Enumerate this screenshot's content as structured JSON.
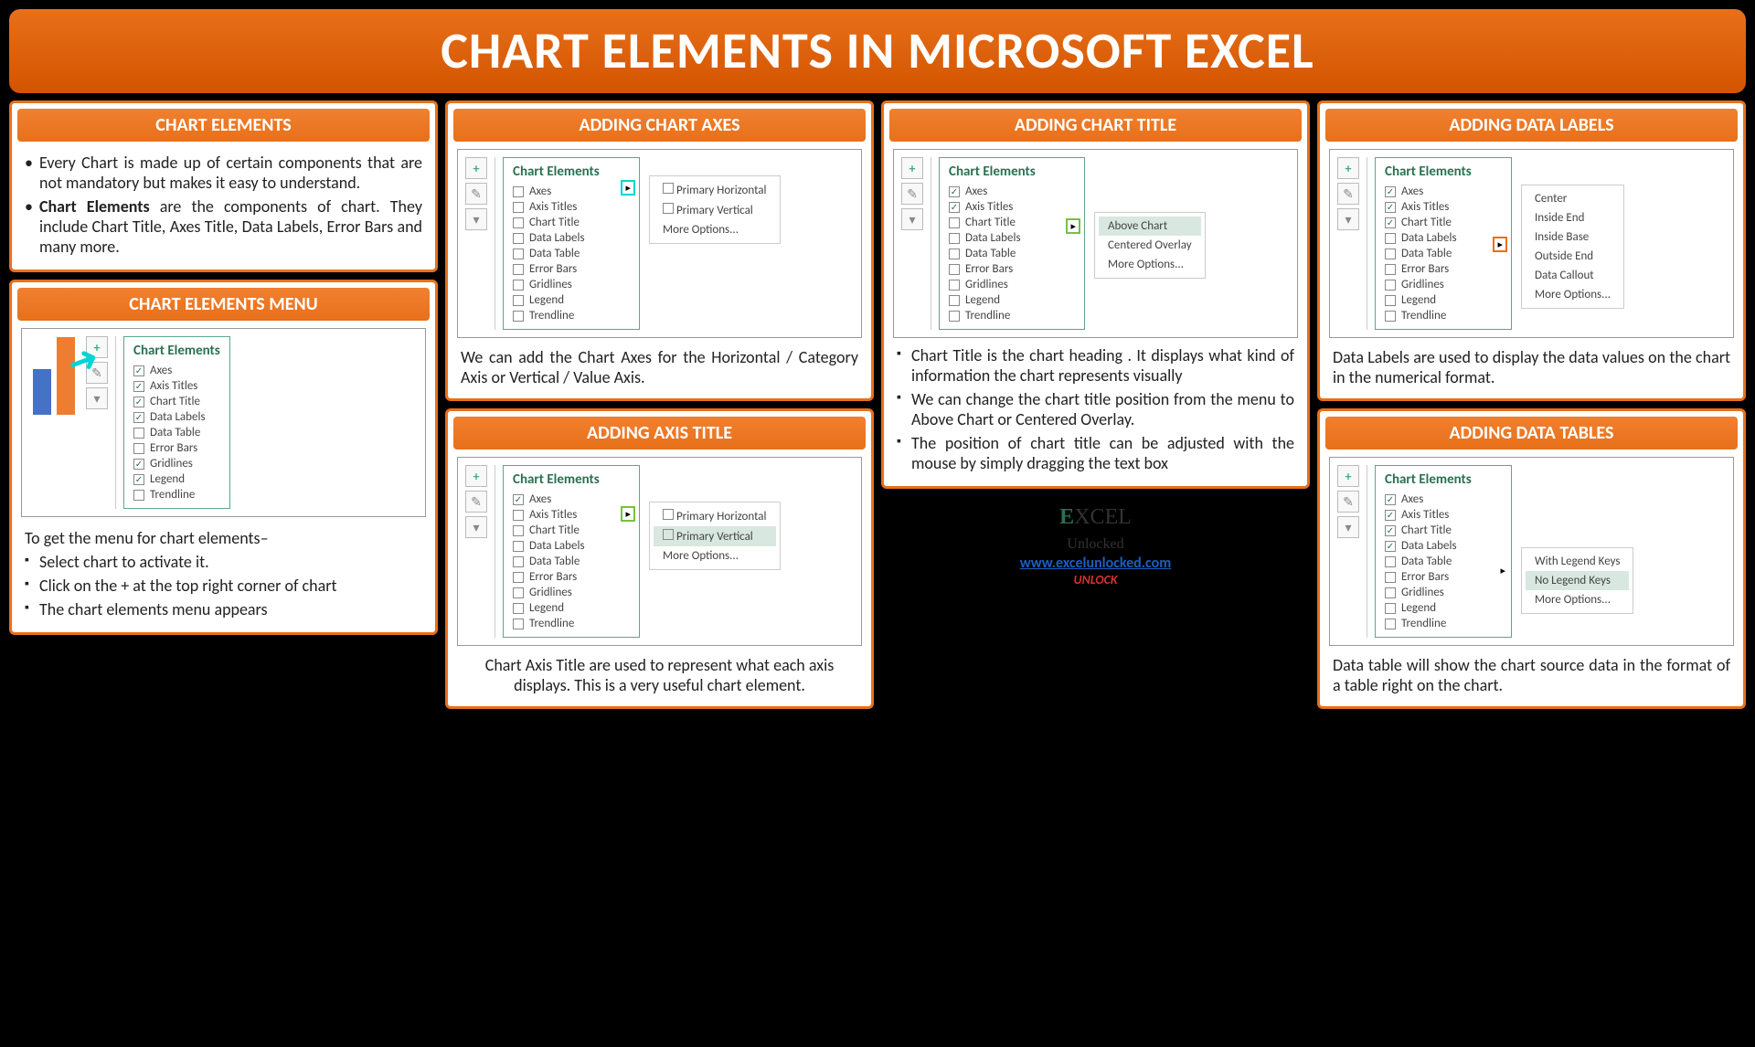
{
  "title": "CHART ELEMENTS IN MICROSOFT EXCEL",
  "cards": {
    "elements": {
      "title": "CHART ELEMENTS",
      "bullets": [
        "Every Chart is made up of certain components that are not mandatory but makes it easy to understand.",
        "Chart Elements are the components of chart. They include Chart Title, Axes Title, Data Labels, Error Bars and many more."
      ]
    },
    "menu": {
      "title": "CHART ELEMENTS MENU",
      "intro": "To get the menu for chart elements–",
      "bullets": [
        "Select chart to activate it.",
        "Click on the + at the top right corner of chart",
        "The chart elements menu appears"
      ]
    },
    "axes": {
      "title": "ADDING CHART AXES",
      "caption": "We can add the Chart Axes for the Horizontal / Category Axis or Vertical / Value Axis.",
      "submenu": [
        "Primary Horizontal",
        "Primary Vertical",
        "More Options..."
      ]
    },
    "axisTitle": {
      "title": "ADDING AXIS TITLE",
      "caption": "Chart Axis Title are used to represent what each axis displays. This is a very useful chart element.",
      "submenu": [
        "Primary Horizontal",
        "Primary Vertical",
        "More Options..."
      ]
    },
    "chartTitle": {
      "title": "ADDING CHART TITLE",
      "submenu": [
        "Above Chart",
        "Centered Overlay",
        "More Options..."
      ],
      "bullets": [
        "Chart Title is the chart heading . It displays what kind of information the chart represents visually",
        "We can change the chart title position from the menu to Above Chart or Centered Overlay.",
        "The position of chart title can be adjusted with the mouse by simply dragging the text box"
      ]
    },
    "dataLabels": {
      "title": "ADDING DATA LABELS",
      "caption": "Data Labels are used to display the data values on the chart in the numerical format.",
      "submenu": [
        "Center",
        "Inside End",
        "Inside Base",
        "Outside End",
        "Data Callout",
        "More Options..."
      ]
    },
    "dataTables": {
      "title": "ADDING DATA TABLES",
      "caption": "Data table will show the chart source data in the format of a table right on the chart.",
      "submenu": [
        "With Legend Keys",
        "No Legend Keys",
        "More Options..."
      ]
    }
  },
  "chartElements": {
    "panelTitle": "Chart Elements",
    "items": [
      "Axes",
      "Axis Titles",
      "Chart Title",
      "Data Labels",
      "Data Table",
      "Error Bars",
      "Gridlines",
      "Legend",
      "Trendline"
    ]
  },
  "footer": {
    "brand1": "E",
    "brand2": "XCEL",
    "brand3": "Unlocked",
    "url": "www.excelunlocked.com",
    "tagline": "UNLOCK"
  }
}
